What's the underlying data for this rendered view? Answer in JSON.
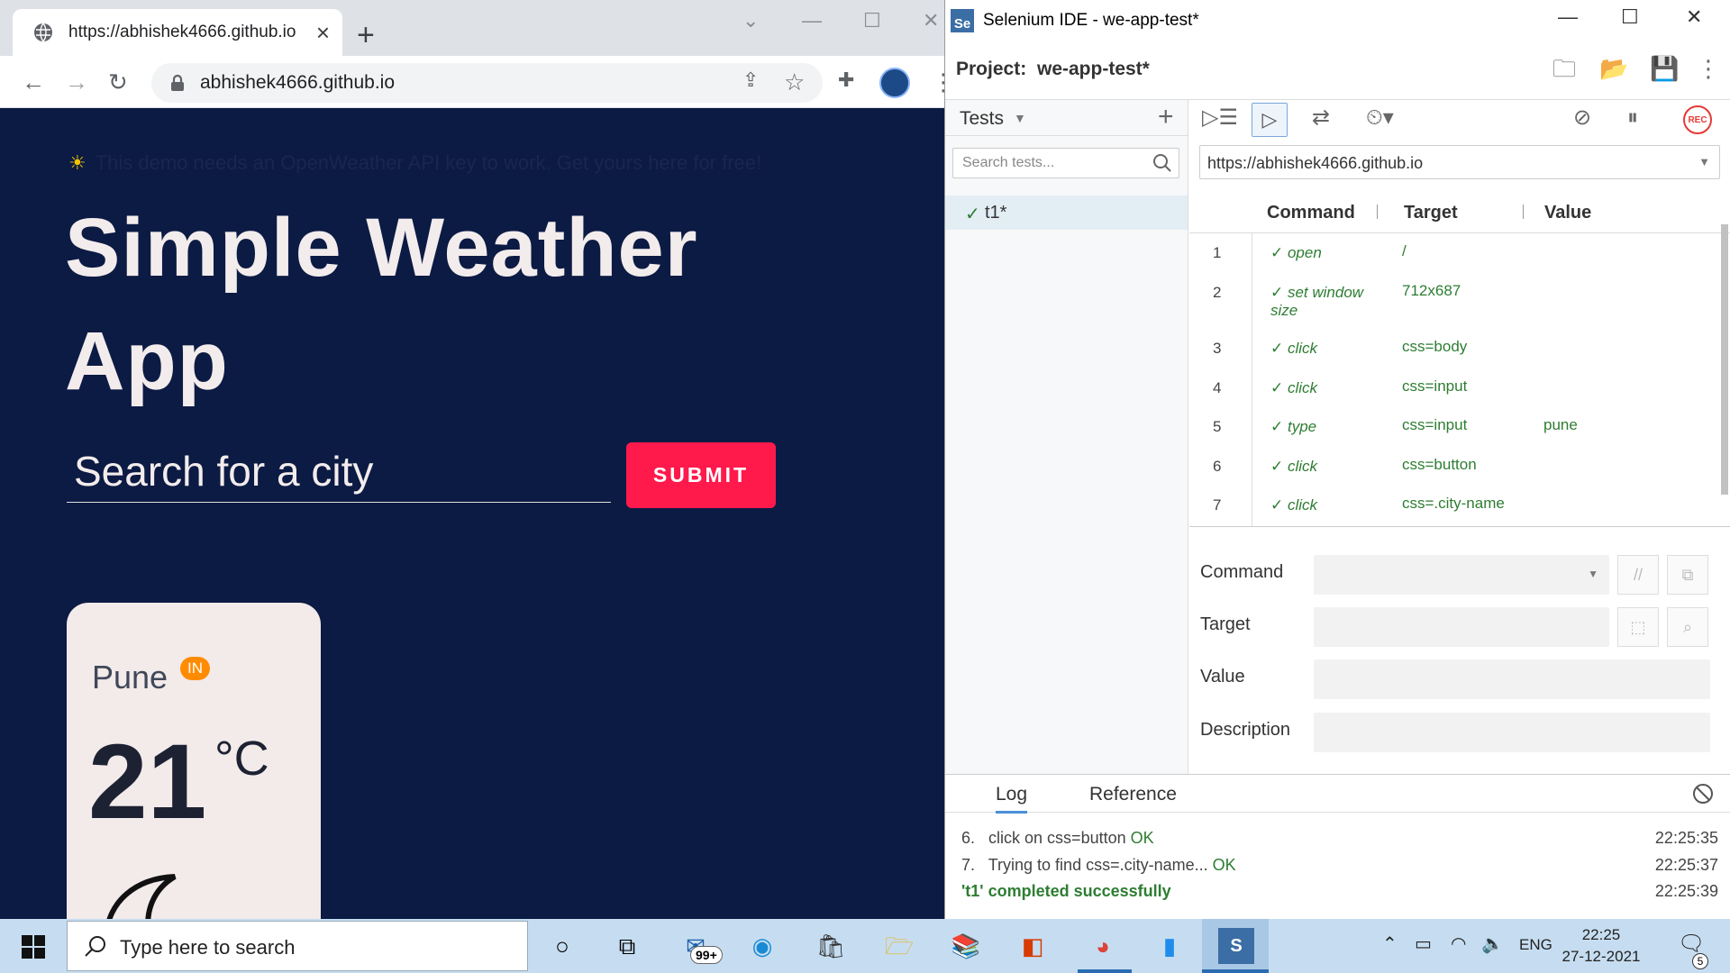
{
  "browser": {
    "tab_title": "https://abhishek4666.github.io",
    "address": "abhishek4666.github.io"
  },
  "weather_app": {
    "notice": "This demo needs an OpenWeather API key to work. Get yours here for free!",
    "title": "Simple Weather App",
    "search_placeholder": "Search for a city",
    "submit_label": "SUBMIT",
    "card": {
      "city": "Pune",
      "country": "IN",
      "temp": "21",
      "unit": "°C"
    }
  },
  "ide": {
    "window_title": "Selenium IDE - we-app-test*",
    "project_label": "Project:",
    "project_name": "we-app-test*",
    "tests_label": "Tests",
    "search_placeholder": "Search tests...",
    "tests": [
      {
        "name": "t1*",
        "status": "✓"
      }
    ],
    "base_url": "https://abhishek4666.github.io",
    "columns": {
      "command": "Command",
      "target": "Target",
      "value": "Value"
    },
    "commands": [
      {
        "num": "1",
        "command": "open",
        "target": "/",
        "value": ""
      },
      {
        "num": "2",
        "command": "set window size",
        "target": "712x687",
        "value": ""
      },
      {
        "num": "3",
        "command": "click",
        "target": "css=body",
        "value": ""
      },
      {
        "num": "4",
        "command": "click",
        "target": "css=input",
        "value": ""
      },
      {
        "num": "5",
        "command": "type",
        "target": "css=input",
        "value": "pune"
      },
      {
        "num": "6",
        "command": "click",
        "target": "css=button",
        "value": ""
      },
      {
        "num": "7",
        "command": "click",
        "target": "css=.city-name",
        "value": ""
      }
    ],
    "form": {
      "command_label": "Command",
      "target_label": "Target",
      "value_label": "Value",
      "description_label": "Description"
    },
    "log_tabs": [
      "Log",
      "Reference"
    ],
    "log": [
      {
        "num": "6.",
        "text": "click on css=button",
        "ok": "OK",
        "time": "22:25:35"
      },
      {
        "num": "7.",
        "text": "Trying to find css=.city-name...",
        "ok": "OK",
        "time": "22:25:37"
      }
    ],
    "log_done": {
      "text": "'t1' completed successfully",
      "time": "22:25:39"
    }
  },
  "taskbar": {
    "search_placeholder": "Type here to search",
    "mail_badge": "99+",
    "language": "ENG",
    "time": "22:25",
    "date": "27-12-2021",
    "notification_count": "5"
  },
  "colors": {
    "app_bg": "#0c1b44",
    "submit": "#ff1a4b",
    "card": "#f3eaea",
    "pass_green": "#2e7d32",
    "taskbar": "#c6ddf1"
  }
}
